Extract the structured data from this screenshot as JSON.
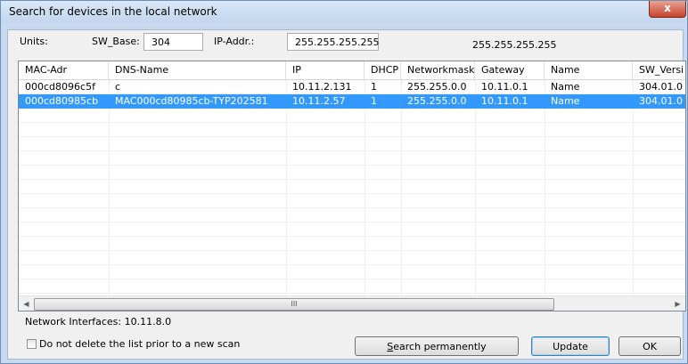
{
  "window": {
    "title": "Search for devices in the local network",
    "close_label": "x"
  },
  "settings": {
    "units_label": "Units:",
    "sw_base_label": "SW_Base:",
    "sw_base_value": "304",
    "ip_addr_label": "IP-Addr.:",
    "ip_addr_value": "255.255.255.255",
    "broadcast_display": "255.255.255.255"
  },
  "table": {
    "columns": [
      "MAC-Adr",
      "DNS-Name",
      "IP",
      "DHCP",
      "Networkmask",
      "Gateway",
      "Name",
      "SW_Versi"
    ],
    "rows": [
      [
        "000cd8096c5f",
        "c",
        "10.11.2.131",
        "1",
        "255.255.0.0",
        "10.11.0.1",
        "Name",
        "304.01.0"
      ],
      [
        "000cd80985cb",
        "MAC000cd80985cb-TYP202581",
        "10.11.2.57",
        "1",
        "255.255.0.0",
        "10.11.0.1",
        "Name",
        "304.01.0"
      ]
    ],
    "selected_row": 1,
    "scroll": {
      "left_arrow": "◀",
      "right_arrow": "▶",
      "thumb_grip": "III"
    }
  },
  "footer": {
    "network_interfaces": "Network Interfaces: 10.11.8.0",
    "keep_list_label": "Do not delete the list prior to a new scan",
    "keep_list_checked": false,
    "search_button": "Search permanently",
    "update_button": "Update",
    "ok_button": "OK"
  }
}
